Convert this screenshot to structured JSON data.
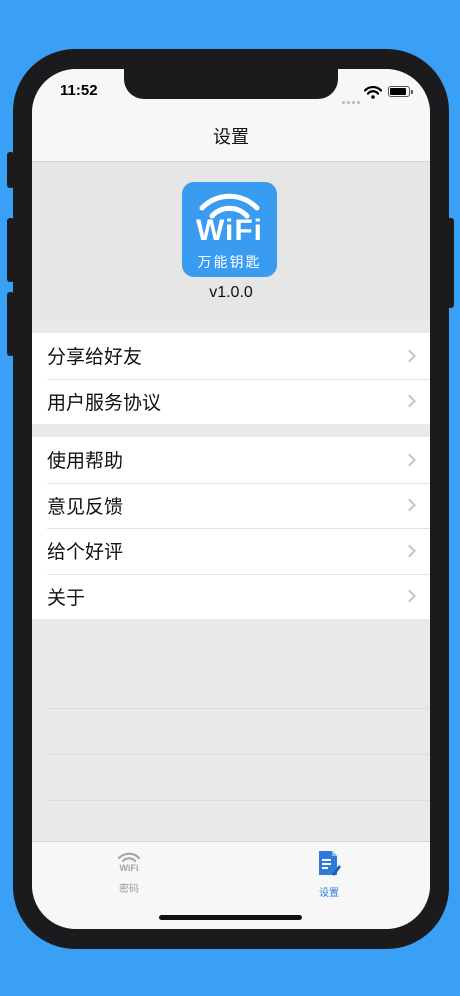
{
  "status_bar": {
    "time": "11:52"
  },
  "nav": {
    "title": "设置"
  },
  "header": {
    "icon_text": "WiFi",
    "icon_subtext": "万能钥匙",
    "version": "v1.0.0"
  },
  "group1": [
    {
      "label": "分享给好友"
    },
    {
      "label": "用户服务协议"
    }
  ],
  "group2": [
    {
      "label": "使用帮助"
    },
    {
      "label": "意见反馈"
    },
    {
      "label": "给个好评"
    },
    {
      "label": "关于"
    }
  ],
  "tabbar": {
    "password": {
      "label": "密码",
      "icon": "wifi-icon"
    },
    "settings": {
      "label": "设置",
      "icon": "document-edit-icon"
    }
  },
  "colors": {
    "background": "#3aa0f5",
    "accent": "#2f7bd8",
    "icon_bg": "#3a9cf0"
  }
}
